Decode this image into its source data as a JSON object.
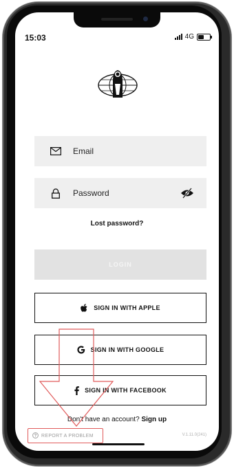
{
  "status_bar": {
    "time": "15:03",
    "network": "4G"
  },
  "login_form": {
    "email_placeholder": "Email",
    "password_placeholder": "Password",
    "lost_password": "Lost password?",
    "login_label": "LOGIN"
  },
  "social": {
    "apple_label": "SIGN IN WITH APPLE",
    "google_label": "SIGN IN WITH GOOGLE",
    "facebook_label": "SIGN IN WITH FACEBOOK"
  },
  "signup": {
    "prompt": "Don't have an account?",
    "link": "Sign up"
  },
  "footer": {
    "report_label": "REPORT A PROBLEM",
    "version": "V.1.11.0(241)"
  },
  "colors": {
    "annotation": "#e05a5a",
    "login_disabled": "#e2e2e2",
    "field_bg": "#efefef"
  },
  "icons": {
    "email": "envelope-icon",
    "password": "lock-icon",
    "visibility": "eye-slash-icon",
    "apple": "apple-icon",
    "google": "google-icon",
    "facebook": "facebook-icon",
    "report": "question-icon"
  }
}
